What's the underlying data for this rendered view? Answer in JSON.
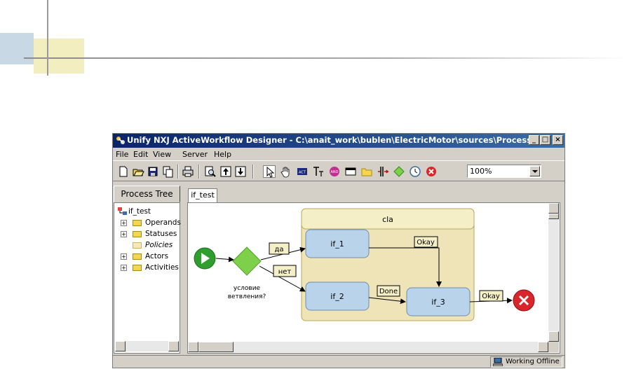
{
  "window": {
    "title": "Unify NXJ ActiveWorkflow Designer - C:\\anait_work\\bublen\\ElectricMotor\\sources\\Process_Definiti...",
    "controls": {
      "minimize": "_",
      "maximize": "□",
      "close": "×"
    }
  },
  "menu": [
    "File",
    "Edit",
    "View",
    "Server",
    "Help"
  ],
  "toolbar": {
    "icons": [
      "new-icon",
      "open-icon",
      "save-icon",
      "copy-icon",
      "print-icon",
      "find-icon",
      "upload-icon",
      "download-icon",
      "pointer-icon",
      "hand-icon",
      "act-icon",
      "t-icon",
      "and-icon",
      "window-icon",
      "folder-tab-icon",
      "split-icon",
      "diamond-icon",
      "timer-icon",
      "stop-icon"
    ],
    "zoom": "100%"
  },
  "left": {
    "tab": "Process Tree",
    "tree": [
      {
        "label": "if_test",
        "kind": "root"
      },
      {
        "label": "Operands",
        "kind": "folder",
        "expandable": true
      },
      {
        "label": "Statuses",
        "kind": "folder",
        "expandable": true
      },
      {
        "label": "Policies",
        "kind": "folder",
        "expandable": false,
        "italic": true
      },
      {
        "label": "Actors",
        "kind": "folder",
        "expandable": true
      },
      {
        "label": "Activities",
        "kind": "folder",
        "expandable": true
      }
    ]
  },
  "editor": {
    "tab": "if_test",
    "diagram": {
      "container": "cla",
      "nodes": {
        "if_1": "if_1",
        "if_2": "if_2",
        "if_3": "if_3"
      },
      "condition": [
        "условие",
        "ветвления?"
      ],
      "edge_labels": {
        "yes": "да",
        "no": "нет",
        "done": "Done",
        "okay_top": "Okay",
        "okay_end": "Okay"
      }
    }
  },
  "status": {
    "text": "Working Offline"
  },
  "colors": {
    "title_start": "#0a246a",
    "title_end": "#3a6ea5",
    "node_fill": "#b9d3ea",
    "container_fill": "#efe3b8",
    "start": "#2f9e2f",
    "decision": "#7ed04a",
    "end": "#d8262a"
  }
}
